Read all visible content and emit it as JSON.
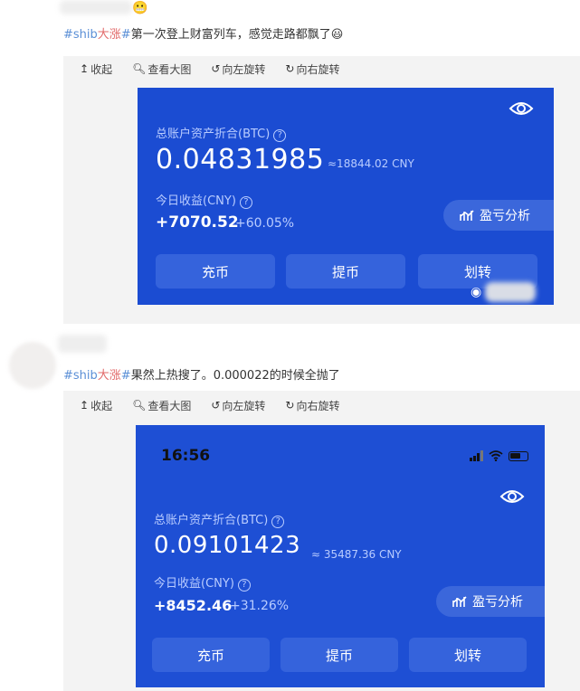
{
  "posts": [
    {
      "text_tag_prefix": "#shib",
      "text_tag_highlight": "大涨",
      "text_tag_suffix": "#",
      "text_body": "第一次登上财富列车，感觉走路都飘了",
      "emoji_after_name": "😬",
      "emoji_end": "😃",
      "toolbar": [
        "收起",
        "查看大图",
        "向左旋转",
        "向右旋转"
      ],
      "card": {
        "asset_label": "总账户资产折合(BTC)",
        "asset_value": "0.04831985",
        "asset_cny": "≈18844.02 CNY",
        "income_label": "今日收益(CNY)",
        "income_value": "+7070.52",
        "income_pct": "+60.05%",
        "analysis_label": "盈亏分析",
        "buttons": [
          "充币",
          "提币",
          "划转"
        ]
      }
    },
    {
      "text_tag_prefix": "#shib",
      "text_tag_highlight": "大涨",
      "text_tag_suffix": "#",
      "text_body": "果然上热搜了。0.000022的时候全抛了",
      "toolbar": [
        "收起",
        "查看大图",
        "向左旋转",
        "向右旋转"
      ],
      "card": {
        "status_time": "16:56",
        "asset_label": "总账户资产折合(BTC)",
        "asset_value": "0.09101423",
        "asset_cny": "≈ 35487.36 CNY",
        "income_label": "今日收益(CNY)",
        "income_value": "+8452.46",
        "income_pct": "+31.26%",
        "analysis_label": "盈亏分析",
        "buttons": [
          "充币",
          "提币",
          "划转"
        ]
      }
    }
  ],
  "icons": {
    "collapse": "collapse-icon",
    "zoom": "magnifier-icon",
    "rotate_left": "rotate-left-icon",
    "rotate_right": "rotate-right-icon",
    "eye": "eye-icon",
    "chart": "chart-icon"
  },
  "colors": {
    "card_blue": "#1b4cd2",
    "hashtag_blue": "#5b8fd6",
    "hashtag_highlight": "#e26a6a"
  }
}
